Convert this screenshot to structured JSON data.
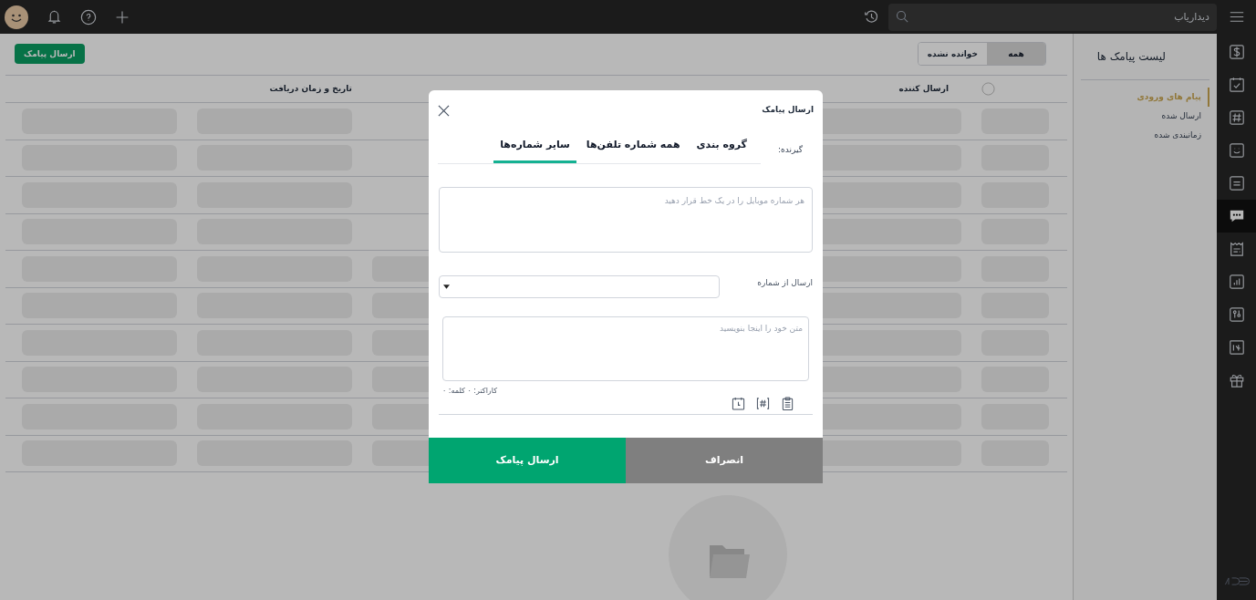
{
  "top_bar": {
    "search": {
      "placeholder": "دیداریاب"
    }
  },
  "rail": [
    {
      "selected": false
    },
    {
      "selected": false
    },
    {
      "selected": false
    },
    {
      "selected": false
    },
    {
      "selected": false
    },
    {
      "selected": true
    },
    {
      "selected": false
    },
    {
      "selected": false
    },
    {
      "selected": false
    },
    {
      "selected": false
    },
    {
      "selected": false
    }
  ],
  "sidebar": {
    "title": "لیست پیامک ها",
    "items": [
      {
        "label": "پیام های ورودی",
        "selected": true
      },
      {
        "label": "ارسال شده",
        "selected": false
      },
      {
        "label": "زمانبندی شده",
        "selected": false
      }
    ]
  },
  "filter": [
    {
      "label": "همه",
      "selected": true
    },
    {
      "label": "خوانده نشده",
      "selected": false
    }
  ],
  "send_button": "ارسال پیامک",
  "table": {
    "select_all": {
      "checked": false
    },
    "columns": [
      {
        "label": "ارسال کننده"
      },
      {
        "label": "تاریخ و زمان دریافت"
      }
    ]
  },
  "dialog": {
    "title": "ارسال پیامک",
    "recipient_label": "گیرنده:",
    "tabs": [
      {
        "label": "گروه بندی",
        "selected": false
      },
      {
        "label": "همه شماره تلفن‌ها",
        "selected": false
      },
      {
        "label": "سایر شماره‌ها",
        "selected": true
      }
    ],
    "numbers_placeholder": "هر شماره موبایل را در یک خط قرار دهید",
    "from_label": "ارسال از شماره",
    "message_placeholder": "متن خود را اینجا بنویسید",
    "counter": "کاراکتر: ۰ کلمه: ۰",
    "buttons": [
      {
        "kind": "secondary",
        "label": "انصراف"
      },
      {
        "kind": "primary",
        "label": "ارسال پیامک"
      }
    ]
  }
}
